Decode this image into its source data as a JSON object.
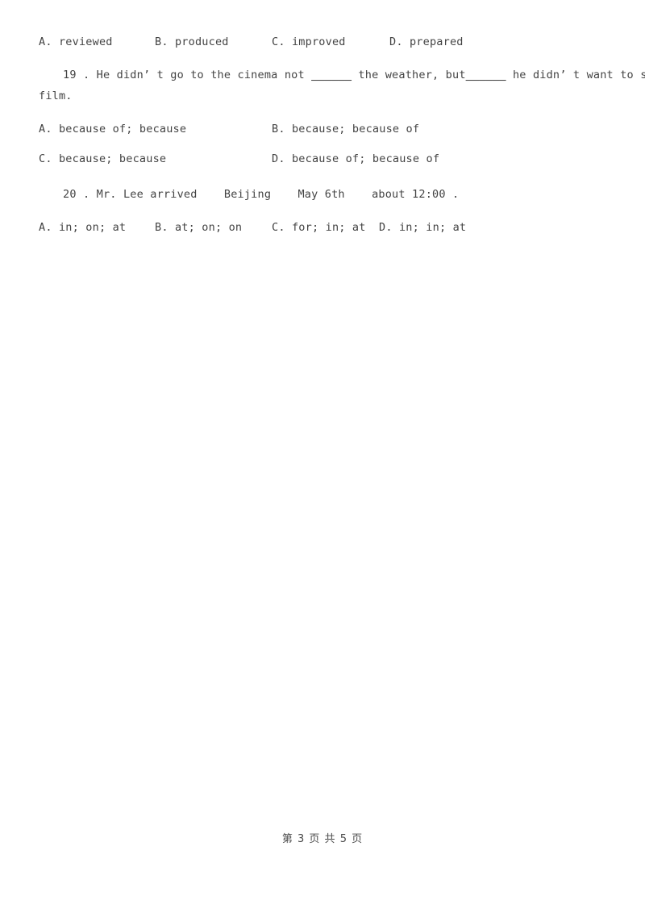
{
  "document": {
    "page_footer": "第 3 页 共 5 页",
    "page_number": "3",
    "total_pages": "5"
  },
  "blocks": {
    "q18_options": {
      "a": "A. reviewed",
      "b": "B. produced",
      "c": "C. improved",
      "d": "D. prepared"
    },
    "q19": {
      "line1_pre": "19 . He didn’ t go to the cinema not ",
      "blank1": "______",
      "line1_mid": " the weather, but",
      "blank2": "______",
      "line1_post": " he didn’ t want to see the",
      "line2": "film.",
      "options": {
        "a": "A. because of; because",
        "b": "B. because; because of",
        "c": "C. because; because",
        "d": "D. because of; because of"
      }
    },
    "q20": {
      "stem": "20 . Mr. Lee arrived    Beijing    May 6th    about 12:00 .",
      "options": {
        "a": "A. in; on; at",
        "b": "B. at; on; on",
        "c": "C. for; in; at",
        "d": "D. in; in; at"
      }
    }
  }
}
